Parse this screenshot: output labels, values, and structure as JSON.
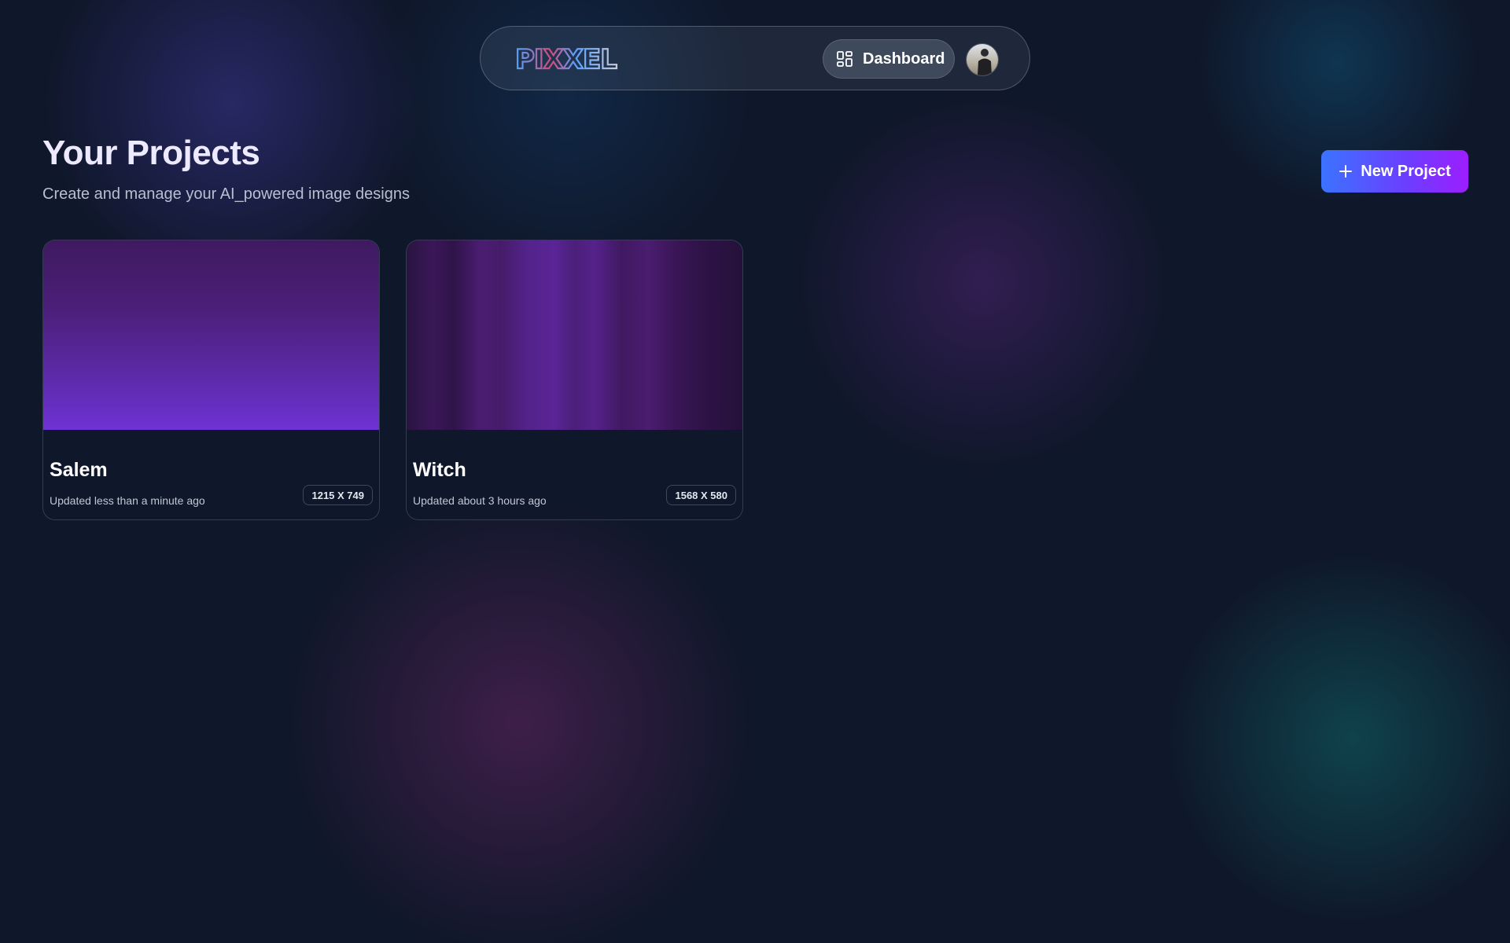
{
  "header": {
    "logo_text": "PIXXEL",
    "dashboard_label": "Dashboard"
  },
  "main": {
    "title": "Your Projects",
    "subtitle": "Create and manage your AI_powered image designs",
    "new_project_label": "New Project"
  },
  "projects": [
    {
      "name": "Salem",
      "updated": "Updated less than a minute ago",
      "dimensions": "1215 X 749"
    },
    {
      "name": "Witch",
      "updated": "Updated about 3 hours ago",
      "dimensions": "1568 X 580"
    }
  ],
  "icons": {
    "dashboard": "layout-grid-icon",
    "new_project": "plus-icon"
  },
  "colors": {
    "background": "#0f172a",
    "accent_start": "#3b73ff",
    "accent_end": "#9d1eff"
  }
}
